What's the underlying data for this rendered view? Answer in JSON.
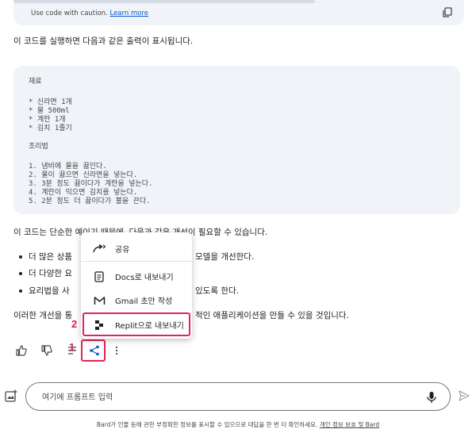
{
  "code_footer": {
    "caution_text": "Use code with caution.",
    "learn_more": "Learn more",
    "copy_icon": "copy-icon"
  },
  "intro": "이 코드를 실행하면 다음과 같은 출력이 표시됩니다.",
  "code_output": [
    "재료",
    "",
    "* 신라면 1개",
    "* 물 500ml",
    "* 계란 1개",
    "* 김치 1줄기",
    "",
    "조리법",
    "",
    "1. 냄비에 물을 끓인다.",
    "2. 물이 끓으면 신라면을 넣는다.",
    "3. 3분 정도 끓이다가 계란을 넣는다.",
    "4. 계란이 익으면 김치를 넣는다.",
    "5. 2분 정도 더 끓이다가 불을 끈다."
  ],
  "improve_intro": "이 코드는 단순한 예이기 때문에, 다음과 같은 개선이 필요할 수 있습니다.",
  "bullets": [
    {
      "left": "더 많은 상품",
      "right": "모델을 개선한다."
    },
    {
      "left": "더 다양한 요",
      "right": ""
    },
    {
      "left": "요리법을 사",
      "right": "있도록 한다."
    }
  ],
  "closing_left": "이러한 개선을 통",
  "closing_right": "적인 애플리케이션을 만들 수 있을 것입니다.",
  "share_menu": {
    "items": [
      {
        "label": "공유",
        "icon": "share-arrow-icon"
      },
      {
        "label": "Docs로 내보내기",
        "icon": "docs-icon"
      },
      {
        "label": "Gmail 초안 작성",
        "icon": "gmail-icon"
      },
      {
        "label": "Replit으로 내보내기",
        "icon": "replit-icon"
      }
    ]
  },
  "annotations": {
    "step1": "1",
    "step2": "2"
  },
  "prompt": {
    "placeholder": "여기에 프롬프트 입력"
  },
  "footer": {
    "text": "Bard가 인물 등에 관한 부정확한 정보를 표시할 수 있으므로 대답을 한 번 더 확인하세요.",
    "link": "개인 정보 보호 및 Bard"
  },
  "colors": {
    "accent_highlight": "#e0245e",
    "link": "#0b57d0",
    "code_bg": "#f0f4f9"
  }
}
